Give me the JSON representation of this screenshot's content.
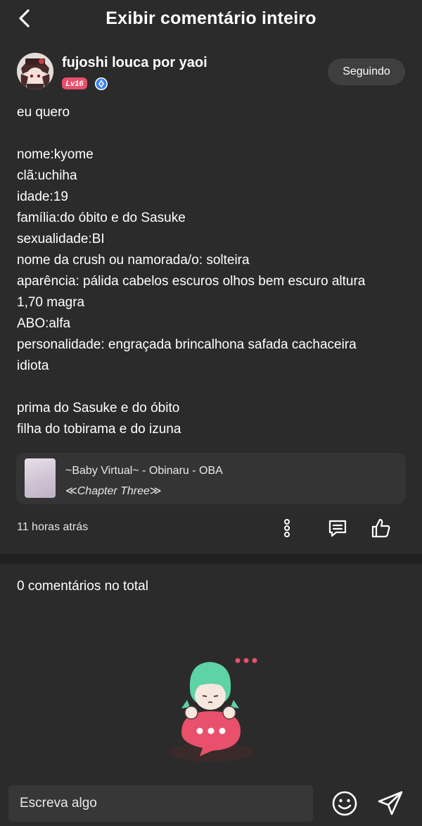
{
  "header": {
    "title": "Exibir comentário inteiro",
    "back_icon": "chevron-left-icon"
  },
  "author": {
    "name": "fujoshi louca por yaoi",
    "level": "Lv16",
    "verified_icon": "diamond-badge-icon",
    "follow_label": "Seguindo"
  },
  "comment": {
    "lines": [
      "eu quero",
      "",
      "nome:kyome",
      "clã:uchiha",
      "idade:19",
      "família:do óbito e do Sasuke",
      "sexualidade:BI",
      "nome da crush ou namorada/o: solteira",
      "aparência: pálida cabelos escuros olhos bem escuro altura",
      "1,70 magra",
      "ABO:alfa",
      "personalidade: engraçada brincalhona safada cachaceira",
      "idiota",
      "",
      "prima do Sasuke e do óbito",
      "filha do tobirama e do izuna"
    ]
  },
  "attachment": {
    "title": "~Baby Virtual~ - Obinaru - OBA",
    "subtitle": "≪Chapter Three≫"
  },
  "meta": {
    "timestamp": "11 horas atrás",
    "icons": [
      "more-vertical-icon",
      "reply-comment-icon",
      "like-thumb-icon"
    ]
  },
  "comments_section": {
    "total_label": "0 comentários no total"
  },
  "composer": {
    "placeholder": "Escreva algo",
    "emoji_icon": "emoji-smile-icon",
    "send_icon": "send-icon"
  },
  "colors": {
    "background": "#2b2b2b",
    "divider": "#202020",
    "level_badge": "#e8506c",
    "verified_badge": "#3b82f6",
    "mascot_hair": "#5ed3a6",
    "mascot_bubble": "#e8506c"
  }
}
